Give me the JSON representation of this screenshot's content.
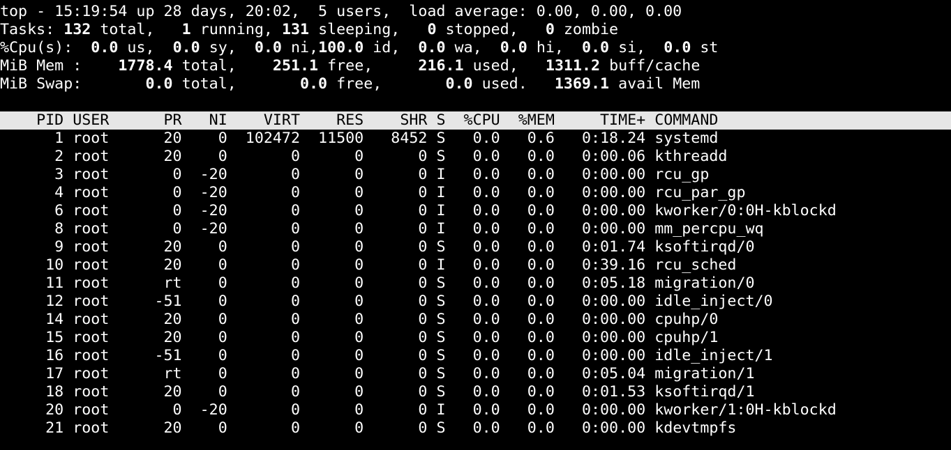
{
  "summary": {
    "line1": "top - 15:19:54 up 28 days, 20:02,  5 users,  load average: 0.00, 0.00, 0.00",
    "tasks": {
      "label": "Tasks:",
      "total": "132",
      "total_label": "total,",
      "running": "1",
      "running_label": "running,",
      "sleeping": "131",
      "sleeping_label": "sleeping,",
      "stopped": "0",
      "stopped_label": "stopped,",
      "zombie": "0",
      "zombie_label": "zombie"
    },
    "cpu": {
      "label": "%Cpu(s):",
      "us": "0.0",
      "us_label": "us,",
      "sy": "0.0",
      "sy_label": "sy,",
      "ni": "0.0",
      "ni_label": "ni,",
      "id": "100.0",
      "id_label": "id,",
      "wa": "0.0",
      "wa_label": "wa,",
      "hi": "0.0",
      "hi_label": "hi,",
      "si": "0.0",
      "si_label": "si,",
      "st": "0.0",
      "st_label": "st"
    },
    "mem": {
      "label": "MiB Mem :",
      "total": "1778.4",
      "total_label": "total,",
      "free": "251.1",
      "free_label": "free,",
      "used": "216.1",
      "used_label": "used,",
      "buff": "1311.2",
      "buff_label": "buff/cache"
    },
    "swap": {
      "label": "MiB Swap:",
      "total": "0.0",
      "total_label": "total,",
      "free": "0.0",
      "free_label": "free,",
      "used": "0.0",
      "used_label": "used.",
      "avail": "1369.1",
      "avail_label": "avail Mem"
    }
  },
  "table": {
    "header": [
      "PID",
      "USER",
      "PR",
      "NI",
      "VIRT",
      "RES",
      "SHR",
      "S",
      "%CPU",
      "%MEM",
      "TIME+",
      "COMMAND"
    ],
    "rows": [
      [
        "1",
        "root",
        "20",
        "0",
        "102472",
        "11500",
        "8452",
        "S",
        "0.0",
        "0.6",
        "0:18.24",
        "systemd"
      ],
      [
        "2",
        "root",
        "20",
        "0",
        "0",
        "0",
        "0",
        "S",
        "0.0",
        "0.0",
        "0:00.06",
        "kthreadd"
      ],
      [
        "3",
        "root",
        "0",
        "-20",
        "0",
        "0",
        "0",
        "I",
        "0.0",
        "0.0",
        "0:00.00",
        "rcu_gp"
      ],
      [
        "4",
        "root",
        "0",
        "-20",
        "0",
        "0",
        "0",
        "I",
        "0.0",
        "0.0",
        "0:00.00",
        "rcu_par_gp"
      ],
      [
        "6",
        "root",
        "0",
        "-20",
        "0",
        "0",
        "0",
        "I",
        "0.0",
        "0.0",
        "0:00.00",
        "kworker/0:0H-kblockd"
      ],
      [
        "8",
        "root",
        "0",
        "-20",
        "0",
        "0",
        "0",
        "I",
        "0.0",
        "0.0",
        "0:00.00",
        "mm_percpu_wq"
      ],
      [
        "9",
        "root",
        "20",
        "0",
        "0",
        "0",
        "0",
        "S",
        "0.0",
        "0.0",
        "0:01.74",
        "ksoftirqd/0"
      ],
      [
        "10",
        "root",
        "20",
        "0",
        "0",
        "0",
        "0",
        "I",
        "0.0",
        "0.0",
        "0:39.16",
        "rcu_sched"
      ],
      [
        "11",
        "root",
        "rt",
        "0",
        "0",
        "0",
        "0",
        "S",
        "0.0",
        "0.0",
        "0:05.18",
        "migration/0"
      ],
      [
        "12",
        "root",
        "-51",
        "0",
        "0",
        "0",
        "0",
        "S",
        "0.0",
        "0.0",
        "0:00.00",
        "idle_inject/0"
      ],
      [
        "14",
        "root",
        "20",
        "0",
        "0",
        "0",
        "0",
        "S",
        "0.0",
        "0.0",
        "0:00.00",
        "cpuhp/0"
      ],
      [
        "15",
        "root",
        "20",
        "0",
        "0",
        "0",
        "0",
        "S",
        "0.0",
        "0.0",
        "0:00.00",
        "cpuhp/1"
      ],
      [
        "16",
        "root",
        "-51",
        "0",
        "0",
        "0",
        "0",
        "S",
        "0.0",
        "0.0",
        "0:00.00",
        "idle_inject/1"
      ],
      [
        "17",
        "root",
        "rt",
        "0",
        "0",
        "0",
        "0",
        "S",
        "0.0",
        "0.0",
        "0:05.04",
        "migration/1"
      ],
      [
        "18",
        "root",
        "20",
        "0",
        "0",
        "0",
        "0",
        "S",
        "0.0",
        "0.0",
        "0:01.53",
        "ksoftirqd/1"
      ],
      [
        "20",
        "root",
        "0",
        "-20",
        "0",
        "0",
        "0",
        "I",
        "0.0",
        "0.0",
        "0:00.00",
        "kworker/1:0H-kblockd"
      ],
      [
        "21",
        "root",
        "20",
        "0",
        "0",
        "0",
        "0",
        "S",
        "0.0",
        "0.0",
        "0:00.00",
        "kdevtmpfs"
      ]
    ]
  }
}
